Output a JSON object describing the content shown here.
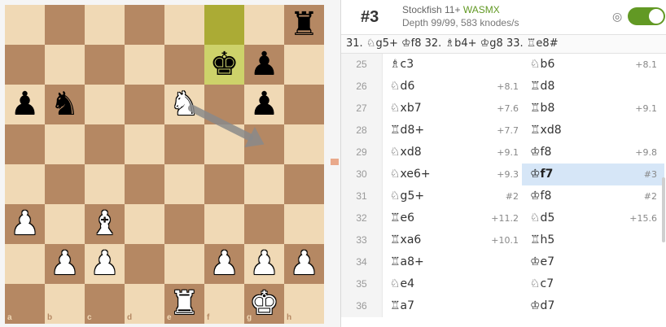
{
  "board": {
    "files": [
      "a",
      "b",
      "c",
      "d",
      "e",
      "f",
      "g",
      "h"
    ],
    "ranks": [
      "8",
      "7",
      "6",
      "5",
      "4",
      "3",
      "2",
      "1"
    ],
    "highlights": [
      "f8",
      "f7"
    ],
    "pieces": [
      {
        "square": "h8",
        "glyph": "♜",
        "color": "b",
        "name": "black-rook-h8"
      },
      {
        "square": "f7",
        "glyph": "♚",
        "color": "b",
        "name": "black-king-f7"
      },
      {
        "square": "g7",
        "glyph": "♟",
        "color": "b",
        "name": "black-pawn-g7"
      },
      {
        "square": "a6",
        "glyph": "♟",
        "color": "b",
        "name": "black-pawn-a6"
      },
      {
        "square": "b6",
        "glyph": "♞",
        "color": "b",
        "name": "black-knight-b6"
      },
      {
        "square": "e6",
        "glyph": "♞",
        "color": "w",
        "name": "white-knight-e6"
      },
      {
        "square": "g6",
        "glyph": "♟",
        "color": "b",
        "name": "black-pawn-g6"
      },
      {
        "square": "a3",
        "glyph": "♟",
        "color": "w",
        "name": "white-pawn-a3"
      },
      {
        "square": "c3",
        "glyph": "♝",
        "color": "w",
        "name": "white-bishop-c3"
      },
      {
        "square": "b2",
        "glyph": "♟",
        "color": "w",
        "name": "white-pawn-b2"
      },
      {
        "square": "c2",
        "glyph": "♟",
        "color": "w",
        "name": "white-pawn-c2"
      },
      {
        "square": "f2",
        "glyph": "♟",
        "color": "w",
        "name": "white-pawn-f2"
      },
      {
        "square": "g2",
        "glyph": "♟",
        "color": "w",
        "name": "white-pawn-g2"
      },
      {
        "square": "h2",
        "glyph": "♟",
        "color": "w",
        "name": "white-pawn-h2"
      },
      {
        "square": "e1",
        "glyph": "♜",
        "color": "w",
        "name": "white-rook-e1"
      },
      {
        "square": "g1",
        "glyph": "♚",
        "color": "w",
        "name": "white-king-g1"
      }
    ],
    "arrow": {
      "from": "e6",
      "to": "g5"
    }
  },
  "engine": {
    "score": "#3",
    "name": "Stockfish 11+",
    "variant": "WASMX",
    "depth": "Depth 99/99, 583 knodes/s",
    "pv": "31. ♘g5+ ♔f8 32. ♗b4+ ♔g8 33. ♖e8#",
    "target_icon": "◎"
  },
  "moves": [
    {
      "num": "25",
      "white": "♗c3",
      "white_eval": "",
      "black": "♘b6",
      "black_eval": "+8.1"
    },
    {
      "num": "26",
      "white": "♘d6",
      "white_eval": "+8.1",
      "black": "♖d8",
      "black_eval": ""
    },
    {
      "num": "27",
      "white": "♘xb7",
      "white_eval": "+7.6",
      "black": "♖b8",
      "black_eval": "+9.1"
    },
    {
      "num": "28",
      "white": "♖d8+",
      "white_eval": "+7.7",
      "black": "♖xd8",
      "black_eval": ""
    },
    {
      "num": "29",
      "white": "♘xd8",
      "white_eval": "+9.1",
      "black": "♔f8",
      "black_eval": "+9.8"
    },
    {
      "num": "30",
      "white": "♘xe6+",
      "white_eval": "+9.3",
      "black": "♔f7",
      "black_eval": "#3",
      "active": true
    },
    {
      "num": "31",
      "white": "♘g5+",
      "white_eval": "#2",
      "black": "♔f8",
      "black_eval": "#2"
    },
    {
      "num": "32",
      "white": "♖e6",
      "white_eval": "+11.2",
      "black": "♘d5",
      "black_eval": "+15.6"
    },
    {
      "num": "33",
      "white": "♖xa6",
      "white_eval": "+10.1",
      "black": "♖h5",
      "black_eval": ""
    },
    {
      "num": "34",
      "white": "♖a8+",
      "white_eval": "",
      "black": "♔e7",
      "black_eval": ""
    },
    {
      "num": "35",
      "white": "♘e4",
      "white_eval": "",
      "black": "♘c7",
      "black_eval": ""
    },
    {
      "num": "36",
      "white": "♖a7",
      "white_eval": "",
      "black": "♔d7",
      "black_eval": ""
    }
  ],
  "colors": {
    "accent": "#629924",
    "active_move_bg": "#d6e6f7",
    "light_square": "#f0d9b5",
    "dark_square": "#b58863"
  }
}
